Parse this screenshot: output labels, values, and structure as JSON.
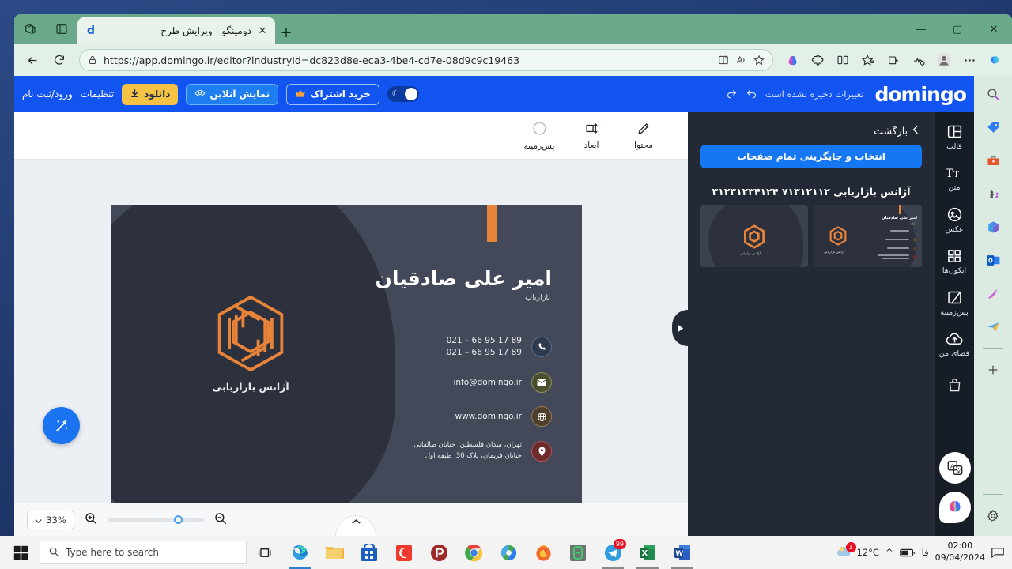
{
  "browser": {
    "tab": {
      "title": "دومینگو | ویرایش طرح",
      "favicon": "d",
      "close_icon": "close-icon"
    },
    "new_tab_label": "+",
    "window_controls": {
      "minimize": "—",
      "maximize": "▢",
      "close": "✕"
    },
    "address": {
      "url": "https://app.domingo.ir/editor?industryId=dc823d8e-eca3-4be4-cd7e-08d9c9c19463",
      "lock_icon": "lock-icon",
      "split_icon": "split-screen-icon",
      "read_aloud_icon": "read-aloud-icon",
      "favorite_icon": "star-icon"
    },
    "toolbar_icons": [
      "copilot-brain-icon",
      "extensions-icon",
      "split-screen-icon",
      "favorites-icon",
      "collections-icon",
      "browser-essentials-icon",
      "profile-icon",
      "settings-more-icon",
      "copilot-icon"
    ],
    "sidebar_icons": [
      "search-icon",
      "shopping-tag-icon",
      "tools-icon",
      "games-icon",
      "microsoft365-icon",
      "outlook-icon",
      "image-creator-icon",
      "drop-icon",
      "add-icon",
      "sidebar-settings-icon"
    ]
  },
  "app": {
    "logo": "domingo",
    "save_status": "تغییرات ذخیره نشده است",
    "undo_icon": "undo-icon",
    "redo_icon": "redo-icon",
    "signin_label": "ورود/ثبت نام",
    "settings_label": "تنظیمات",
    "download_label": "دانلود",
    "preview_label": "نمایش آنلاین",
    "subscribe_label": "خرید اشتراک",
    "theme_toggle": "dark-mode-toggle"
  },
  "tools": [
    {
      "label": "محتوا",
      "icon": "pencil-edit-icon"
    },
    {
      "label": "ابعاد",
      "icon": "resize-icon"
    },
    {
      "label": "پس‌زمینه",
      "icon": "circle-background-icon"
    }
  ],
  "card": {
    "name": "امیر علی صادقیان",
    "role": "بازاریاب",
    "logo_caption": "آژانس بازاریابی",
    "contacts": [
      {
        "icon": "phone-icon",
        "color": "#2e3a4e",
        "text": "021 – 66 95 17 89\n021 – 66 95 17 89",
        "rtl": false
      },
      {
        "icon": "mail-icon",
        "color": "#5c5f3a",
        "text": "info@domingo.ir",
        "rtl": false
      },
      {
        "icon": "globe-icon",
        "color": "#5a4a33",
        "text": "www.domingo.ir",
        "rtl": false
      },
      {
        "icon": "location-pin-icon",
        "color": "#6e2b2b",
        "text": "تهران، میدان فلسطین، خیابان طالقانی،\nخیابان فریمان، پلاک 30، طبقه اول",
        "rtl": true
      }
    ]
  },
  "zoom_bar": {
    "level": "33%",
    "chevron_icon": "chevron-down-icon",
    "zoom_in_icon": "zoom-in-icon",
    "zoom_out_icon": "zoom-out-icon",
    "panel_handle_icon": "chevron-up-icon",
    "magic_icon": "magic-wand-icon"
  },
  "side_panel": {
    "back_label": "بازگشت",
    "back_icon": "chevron-left-icon",
    "replace_all_label": "انتخاب و جایگزینی تمام صفحات",
    "template_title": "آژانس بازاریابی ۷۱۳۱۲۱۱۲ ۳۱۲۳۱۲۳۴۱۲۴",
    "thumbnails": [
      {
        "name": "card-front-thumbnail",
        "caption": "امیر علی صادقیان"
      },
      {
        "name": "card-back-thumbnail",
        "caption": "آژانس بازاریابی"
      }
    ],
    "collapse_icon": "collapse-panel-icon"
  },
  "rail": [
    {
      "label": "قالب",
      "icon": "template-icon"
    },
    {
      "label": "متن",
      "icon": "text-icon"
    },
    {
      "label": "عکس",
      "icon": "image-icon"
    },
    {
      "label": "آیکون‌ها",
      "icon": "icons-grid-icon"
    },
    {
      "label": "پس‌زمینه",
      "icon": "background-icon"
    },
    {
      "label": "فضای من",
      "icon": "cloud-upload-icon"
    },
    {
      "label": "",
      "icon": "shopping-bag-icon"
    }
  ],
  "overlays": {
    "translate_icon": "translate-icon",
    "ai_brain_icon": "ai-brain-icon"
  },
  "taskbar": {
    "start_icon": "windows-start-icon",
    "search_placeholder": "Type here to search",
    "search_icon": "search-icon",
    "taskview_icon": "task-view-icon",
    "apps": [
      {
        "name": "edge-taskbar-icon",
        "state": "active"
      },
      {
        "name": "file-explorer-taskbar-icon",
        "state": "idle"
      },
      {
        "name": "microsoft-store-taskbar-icon",
        "state": "idle"
      },
      {
        "name": "camtasia-taskbar-icon",
        "state": "idle"
      },
      {
        "name": "photoscape-taskbar-icon",
        "state": "idle"
      },
      {
        "name": "chrome-taskbar-icon",
        "state": "idle"
      },
      {
        "name": "idm-taskbar-icon",
        "state": "idle"
      },
      {
        "name": "firefox-taskbar-icon",
        "state": "idle"
      },
      {
        "name": "green-app-taskbar-icon",
        "state": "idle"
      },
      {
        "name": "telegram-taskbar-icon",
        "state": "open",
        "badge": "99"
      },
      {
        "name": "excel-taskbar-icon",
        "state": "open"
      },
      {
        "name": "word-taskbar-icon",
        "state": "open"
      }
    ],
    "weather": {
      "temp": "12°C",
      "icon": "weather-cloud-icon",
      "alert": "1"
    },
    "tray_chevron": "^",
    "tray_icons": [
      "battery-icon"
    ],
    "language": "فا",
    "clock_time": "02:00",
    "clock_date": "09/04/2024",
    "notification_icon": "notification-icon"
  }
}
